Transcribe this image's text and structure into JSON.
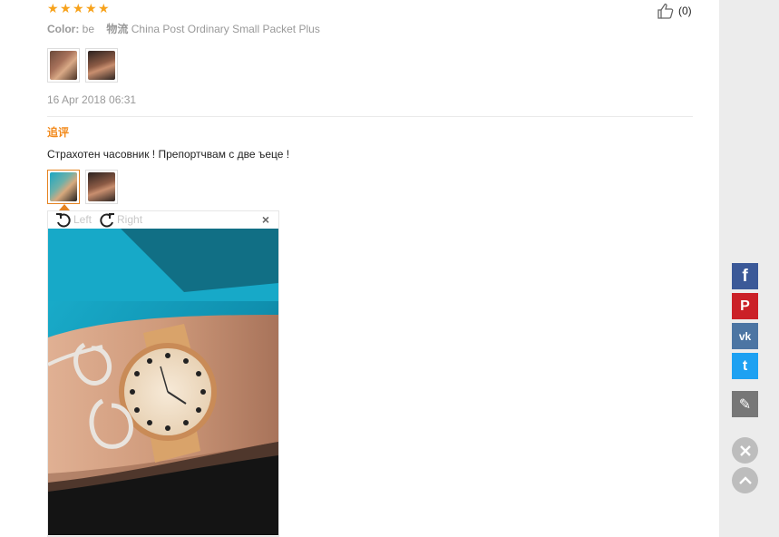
{
  "review": {
    "rating": 5,
    "helpful_count": "(0)",
    "color_label": "Color:",
    "color_value": "be",
    "logistics_label": "物流",
    "logistics_value": "China Post Ordinary Small Packet Plus",
    "date": "16 Apr 2018 06:31",
    "followup_label": "追评",
    "followup_text": "Страхотен часовник ! Препортчвам с две ъеце !"
  },
  "viewer": {
    "left_label": "Left",
    "right_label": "Right",
    "close_label": "×"
  },
  "share": {
    "facebook": "f",
    "pinterest": "P",
    "vk": "vk",
    "twitter": "t",
    "edit": "✎"
  },
  "colors": {
    "star": "#f7a21b",
    "accent": "#f28a1c",
    "facebook": "#3b5998",
    "pinterest": "#cb2027",
    "vk": "#4c75a3",
    "twitter": "#1da1f2"
  }
}
